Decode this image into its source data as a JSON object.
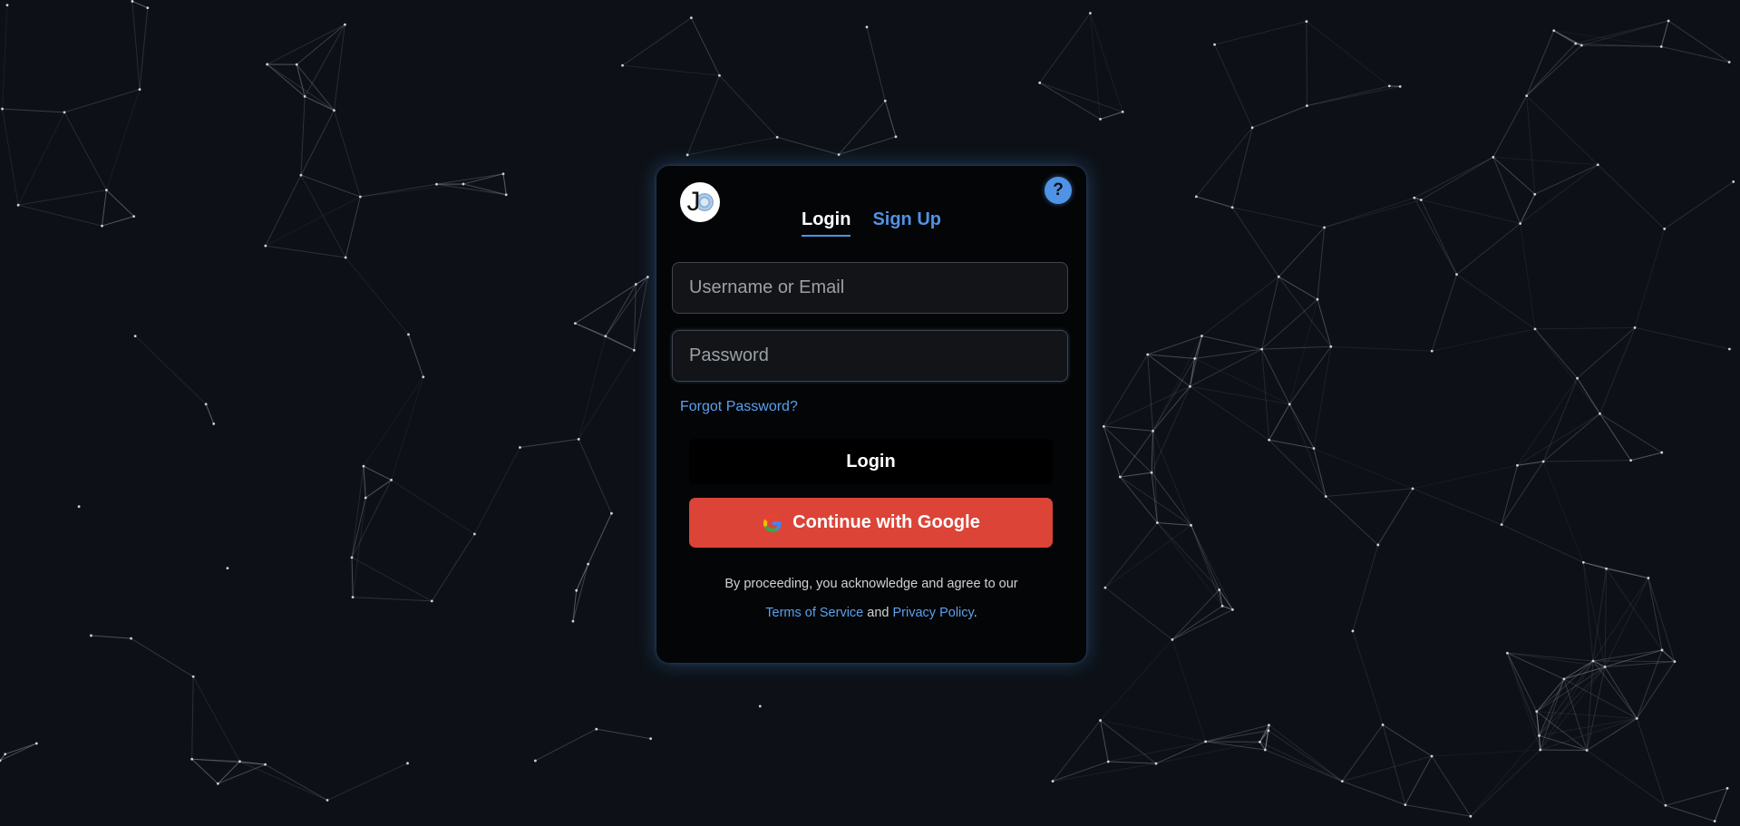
{
  "auth": {
    "tabs": [
      {
        "label": "Login",
        "active": true
      },
      {
        "label": "Sign Up",
        "active": false
      }
    ],
    "help_label": "?",
    "logo_letter": "J",
    "username": {
      "placeholder": "Username or Email",
      "value": ""
    },
    "password": {
      "placeholder": "Password",
      "value": ""
    },
    "forgot_label": "Forgot Password?",
    "login_button": "Login",
    "google_button": "Continue with Google",
    "legal": {
      "prefix": "By proceeding, you acknowledge and agree to our",
      "terms": "Terms of Service",
      "and": "and",
      "privacy": "Privacy Policy",
      "suffix": "."
    }
  },
  "icons": {
    "logo": "logo-icon",
    "help": "question-mark-icon",
    "google": "google-g-icon"
  },
  "colors": {
    "background": "#0d1117",
    "card": "#040506",
    "accent": "#4f93e6",
    "google": "#db4437",
    "network_lines": "#8a8f96"
  }
}
